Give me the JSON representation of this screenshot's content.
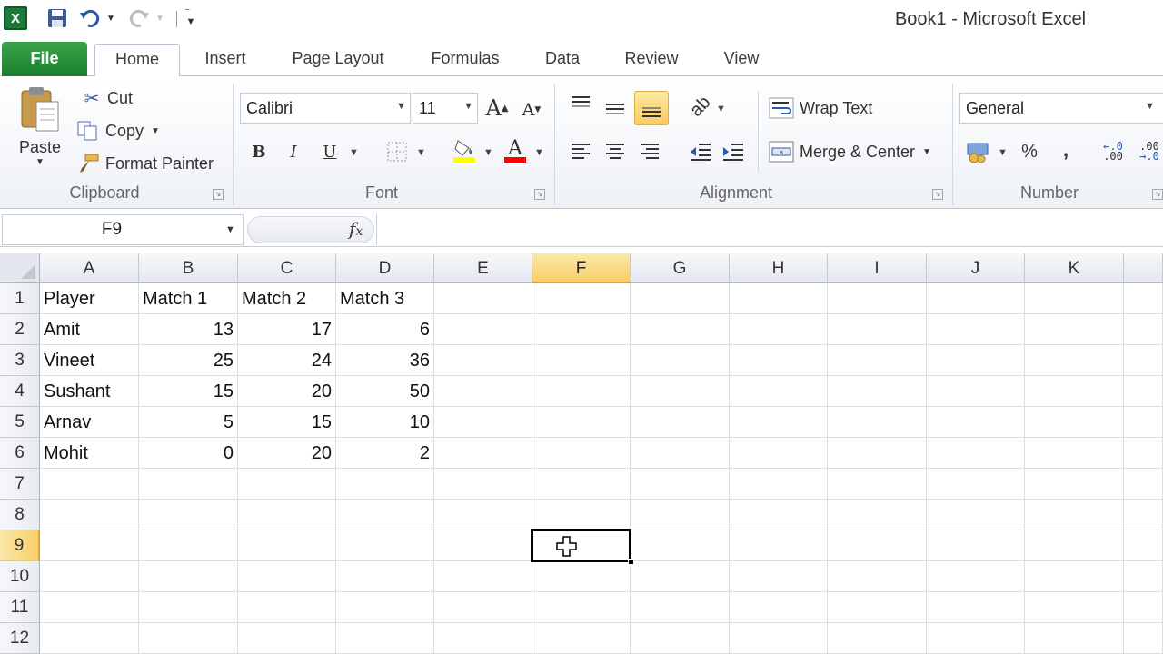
{
  "window": {
    "title": "Book1  -  Microsoft Excel"
  },
  "app_icon": {
    "letter": "X"
  },
  "tabs": [
    "File",
    "Home",
    "Insert",
    "Page Layout",
    "Formulas",
    "Data",
    "Review",
    "View"
  ],
  "ribbon": {
    "clipboard": {
      "paste": "Paste",
      "cut": "Cut",
      "copy": "Copy",
      "format_painter": "Format Painter",
      "group_label": "Clipboard"
    },
    "font": {
      "name": "Calibri",
      "size": "11",
      "bold": "B",
      "italic": "I",
      "underline": "U",
      "group_label": "Font",
      "fill_color": "#ffff00",
      "font_color": "#ff0000"
    },
    "alignment": {
      "wrap_text": "Wrap Text",
      "merge_center": "Merge & Center",
      "group_label": "Alignment"
    },
    "number": {
      "format": "General",
      "percent": "%",
      "comma": ",",
      "group_label": "Number"
    }
  },
  "formula_bar": {
    "name_box": "F9",
    "fx": "fx",
    "formula": ""
  },
  "sheet": {
    "columns": [
      "A",
      "B",
      "C",
      "D",
      "E",
      "F",
      "G",
      "H",
      "I",
      "J",
      "K"
    ],
    "rows": [
      "1",
      "2",
      "3",
      "4",
      "5",
      "6",
      "7",
      "8",
      "9",
      "10",
      "11",
      "12"
    ],
    "active_column": "F",
    "active_row": "9",
    "data": [
      [
        "Player",
        "Match 1",
        "Match 2",
        "Match 3"
      ],
      [
        "Amit",
        "13",
        "17",
        "6"
      ],
      [
        "Vineet",
        "25",
        "24",
        "36"
      ],
      [
        "Sushant",
        "15",
        "20",
        "50"
      ],
      [
        "Arnav",
        "5",
        "15",
        "10"
      ],
      [
        "Mohit",
        "0",
        "20",
        "2"
      ]
    ]
  },
  "colors": {
    "file_tab": "#2a9137",
    "active_header": "#f7cf6a",
    "grid_line": "#dadfe6"
  }
}
